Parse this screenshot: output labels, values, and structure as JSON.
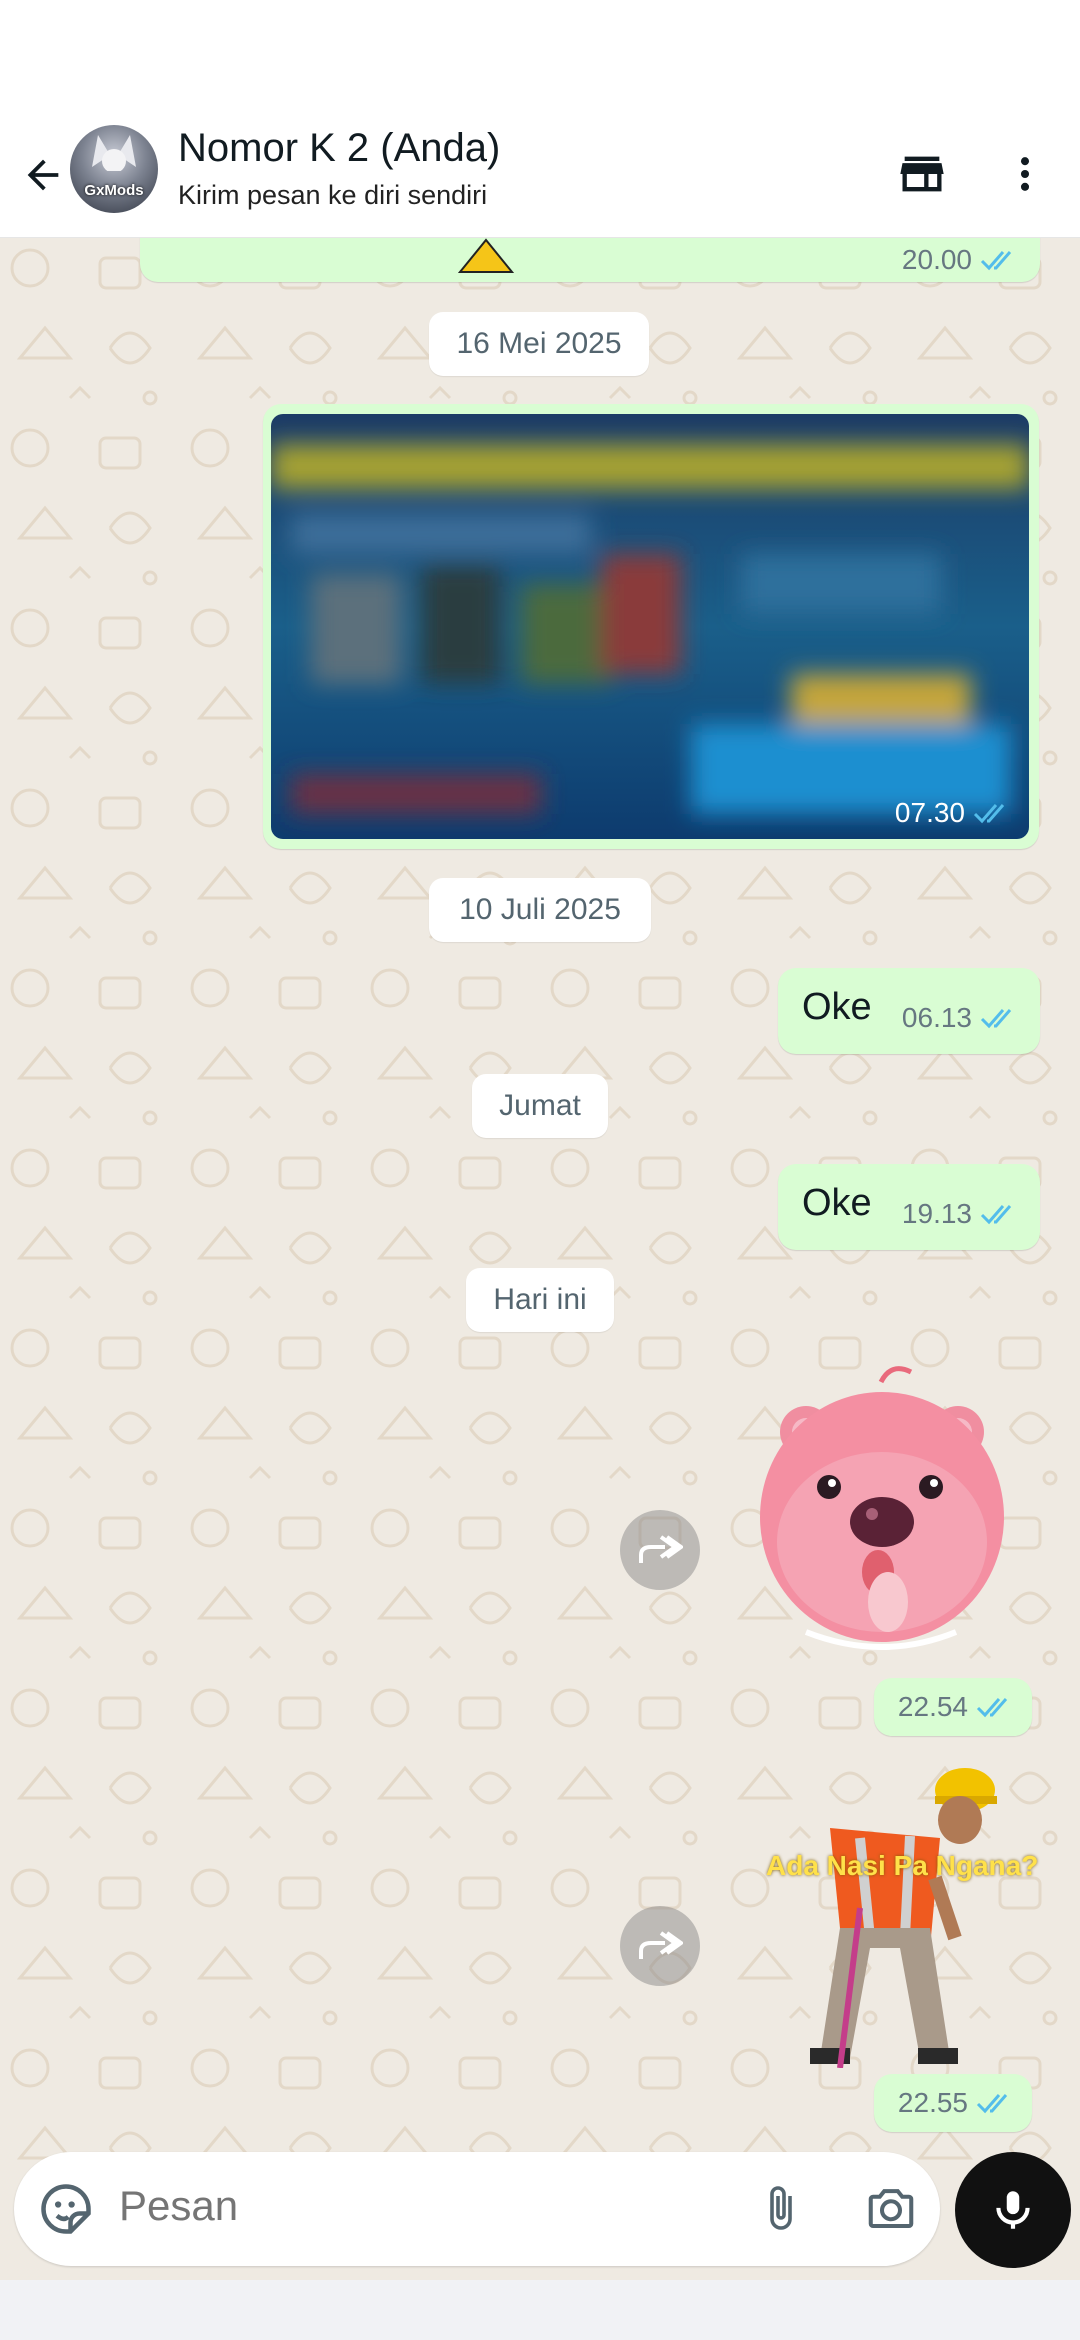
{
  "header": {
    "title": "Nomor K 2 (Anda)",
    "subtitle": "Kirim pesan ke diri sendiri",
    "avatar_text": "GxMods"
  },
  "chat": {
    "top_partial_time": "20.00",
    "date_1": "16 Mei 2025",
    "image_time": "07.30",
    "date_2": "10 Juli 2025",
    "msg_1": {
      "text": "Oke",
      "time": "06.13"
    },
    "date_3": "Jumat",
    "msg_2": {
      "text": "Oke",
      "time": "19.13"
    },
    "date_4": "Hari ini",
    "sticker_1_time": "22.54",
    "sticker_2_caption": "Ada Nasi Pa Ngana?",
    "sticker_2_time": "22.55"
  },
  "composer": {
    "placeholder": "Pesan"
  },
  "icons": {
    "back": "arrow-left-icon",
    "store": "store-icon",
    "more": "more-vertical-icon",
    "read": "double-check-icon",
    "forward": "forward-icon",
    "sticker": "sticker-icon",
    "attach": "paperclip-icon",
    "camera": "camera-icon",
    "mic": "mic-icon"
  },
  "colors": {
    "outgoing_bubble": "#d9fdd3",
    "read_ticks": "#53bdeb",
    "chat_background": "#efeae2"
  }
}
